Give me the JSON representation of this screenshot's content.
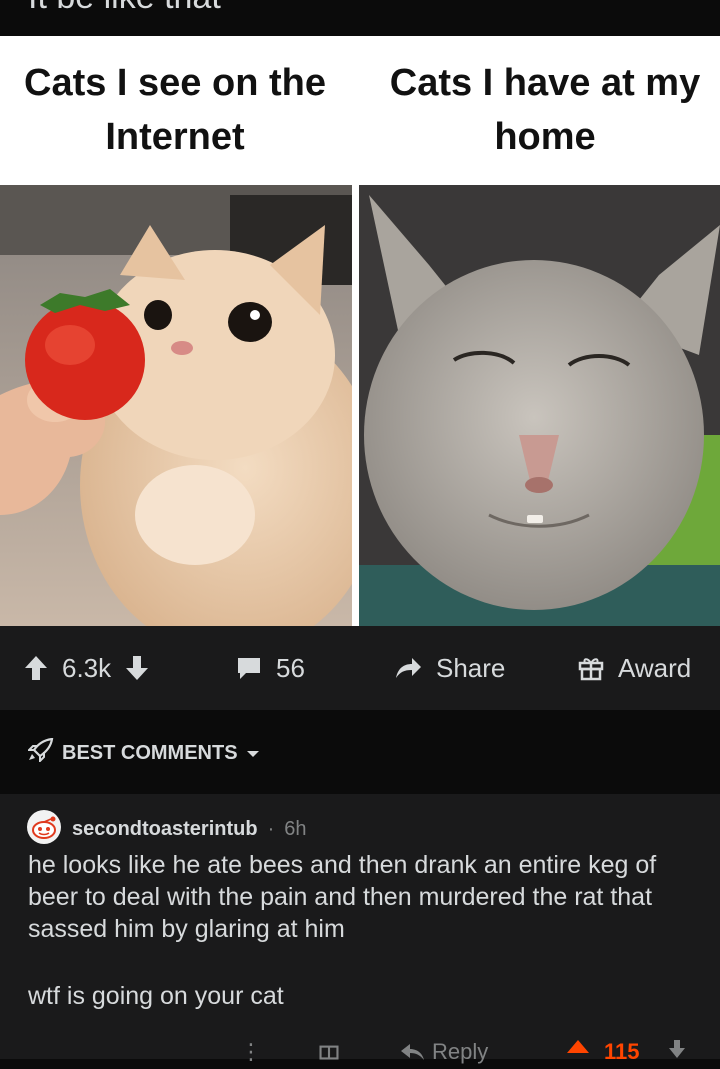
{
  "post": {
    "title": "It be like that",
    "meme": {
      "left_caption": "Cats I see on the Internet",
      "right_caption": "Cats I have at my home"
    }
  },
  "actions": {
    "score": "6.3k",
    "comments": "56",
    "share_label": "Share",
    "award_label": "Award"
  },
  "comments_section": {
    "sort_label": "BEST COMMENTS"
  },
  "comment": {
    "username": "secondtoasterintub",
    "separator": "·",
    "time": "6h",
    "paragraph1": "he looks like he ate bees and then drank an entire keg of beer to deal with the pain and then murdered the rat that sassed him by glaring at him",
    "paragraph2": "wtf is going on your cat",
    "reply_label": "Reply",
    "score": "115"
  },
  "colors": {
    "background": "#0b0b0b",
    "card": "#1a1a1b",
    "text": "#d7dadc",
    "muted": "#818384",
    "upvote": "#ff4500"
  }
}
